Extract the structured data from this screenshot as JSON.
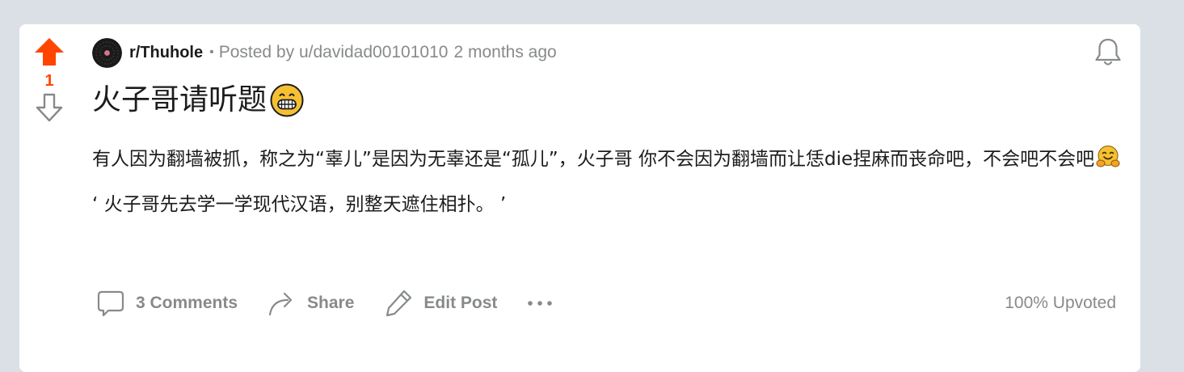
{
  "post": {
    "score": "1",
    "subreddit": "r/Thuhole",
    "dot": "•",
    "posted_by": "Posted by u/davidad00101010",
    "time": "2 months ago",
    "title": "火子哥请听题",
    "title_emoji": "grinning-face-emoji",
    "body": [
      "有人因为翻墙被抓，称之为“辜儿”是因为无辜还是“孤儿”，火子哥 你不会因为翻墙而让恁die捏麻而丧命吧，不会吧不会吧",
      "‘ 火子哥先去学一学现代汉语，别整天遮住相扑。 ’"
    ],
    "body_emoji": "hugging-face-emoji"
  },
  "actions": {
    "comments_label": "3 Comments",
    "share_label": "Share",
    "edit_label": "Edit Post"
  },
  "upvoted": "100% Upvoted",
  "colors": {
    "upvote_active": "#ff4500",
    "muted": "#878a8c",
    "background": "#dae0e6"
  }
}
